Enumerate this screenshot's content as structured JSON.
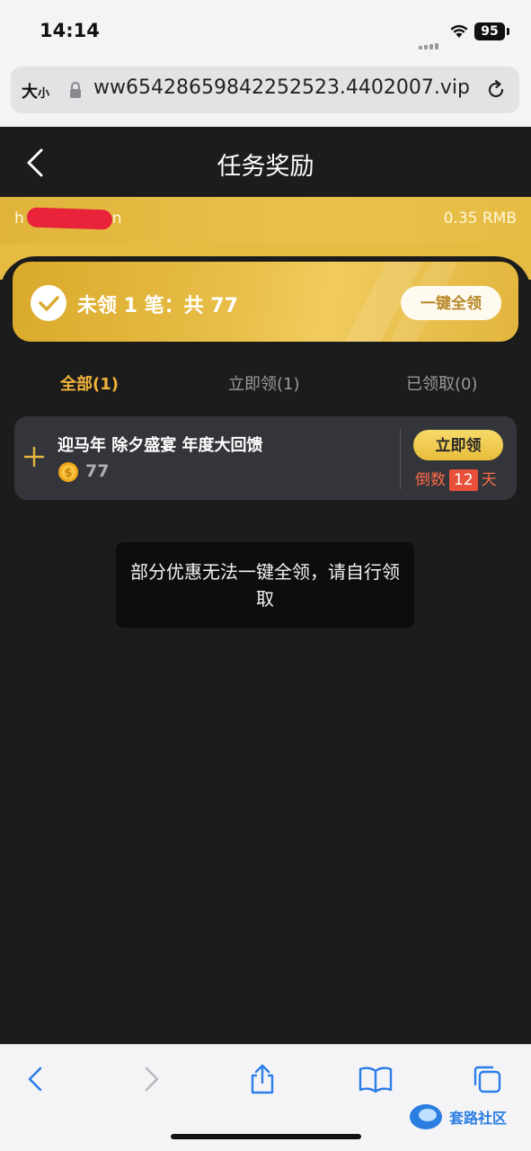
{
  "status_bar": {
    "time": "14:14",
    "battery": "95"
  },
  "browser": {
    "text_size_label": "大",
    "text_size_small": "小",
    "url": "ww6542865984225​2523.4402007.vip"
  },
  "header": {
    "title": "任务奖励"
  },
  "account": {
    "name_prefix": "h",
    "name_suffix": "n",
    "balance": "0.35 RMB"
  },
  "claim_card": {
    "summary": "未领 1 笔：共 77",
    "claim_all_label": "一键全领"
  },
  "tabs": [
    {
      "label": "全部(1)",
      "active": true
    },
    {
      "label": "立即领(1)",
      "active": false
    },
    {
      "label": "已领取(0)",
      "active": false
    }
  ],
  "reward_item": {
    "title": "迎马年 除夕盛宴 年度大回馈",
    "amount": "77",
    "claim_label": "立即领",
    "countdown_prefix": "倒数",
    "countdown_days": "12",
    "countdown_suffix": "天"
  },
  "toast": {
    "message": "部分优惠无法一键全领，请自行领取"
  },
  "watermark": {
    "text": "套路社区"
  },
  "colors": {
    "gold": "#e6bb42",
    "accent_tab": "#f2b43b",
    "countdown": "#ff6a48",
    "background": "#1c1c1c"
  }
}
